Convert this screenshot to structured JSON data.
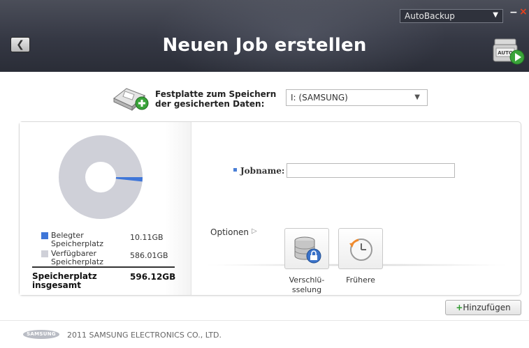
{
  "header": {
    "title": "Neuen Job erstellen",
    "back_icon": "chevron-left-icon",
    "mode_select": {
      "value": "AutoBackup"
    },
    "minimize_glyph": "−",
    "close_glyph": "×",
    "auto_icon_text": "AUTO"
  },
  "disk": {
    "label_line1": "Festplatte zum Speichern",
    "label_line2": "der gesicherten Daten:",
    "selected": "I: (SAMSUNG)"
  },
  "storage": {
    "used_label_1": "Belegter",
    "used_label_2": "Speicherplatz",
    "used_value": "10.11GB",
    "free_label_1": "Verfügbarer",
    "free_label_2": "Speicherplatz",
    "free_value": "586.01GB",
    "total_label_1": "Speicherplatz",
    "total_label_2": "insgesamt",
    "total_value": "596.12GB",
    "used_gb": 10.11,
    "total_gb": 596.12,
    "colors": {
      "used": "#3f76d8",
      "free": "#cfd0d8"
    }
  },
  "job": {
    "name_label": "Jobname:",
    "name_value": ""
  },
  "options": {
    "label": "Optionen",
    "arrow": "▷",
    "items": [
      {
        "line1": "Verschlü-",
        "line2": "sselung",
        "icon": "database-lock-icon"
      },
      {
        "line1": "Frühere",
        "line2": "",
        "icon": "clock-history-icon"
      }
    ]
  },
  "actions": {
    "add_label": "Hinzufügen",
    "add_plus": "+"
  },
  "footer": {
    "logo_text": "SAMSUNG",
    "copyright": "2011 SAMSUNG ELECTRONICS CO., LTD."
  }
}
